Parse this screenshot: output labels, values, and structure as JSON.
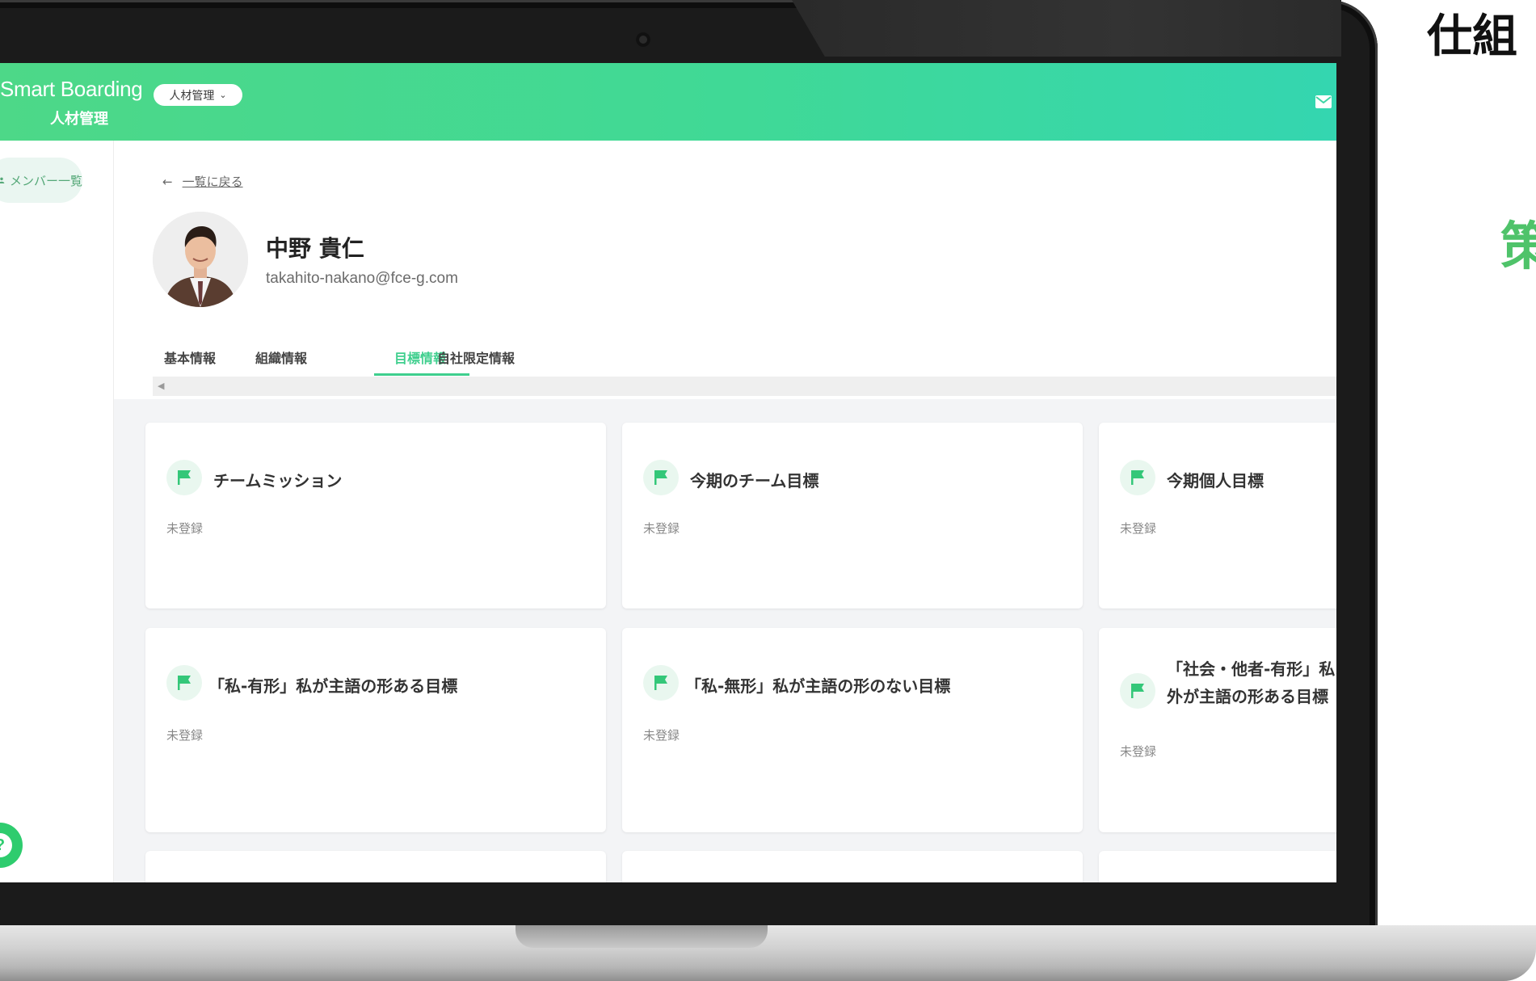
{
  "right_panel": {
    "heading": "仕組",
    "green_text": "策"
  },
  "app": {
    "brand": "Smart Boarding",
    "brand_sub": "人材管理",
    "module_selector": "人材管理"
  },
  "sidebar": {
    "items": [
      {
        "label": "メンバー一覧"
      }
    ]
  },
  "profile": {
    "back_label": "一覧に戻る",
    "name": "中野 貴仁",
    "email": "takahito-nakano@fce-g.com"
  },
  "tabs": [
    {
      "label": "基本情報",
      "active": false
    },
    {
      "label": "組織情報",
      "active": false
    },
    {
      "label": "目標情報",
      "active": true
    },
    {
      "label": "自社限定情報",
      "active": false
    }
  ],
  "goal_cards": [
    {
      "title": "チームミッション",
      "status": "未登録"
    },
    {
      "title": "今期のチーム目標",
      "status": "未登録"
    },
    {
      "title": "今期個人目標",
      "status": "未登録"
    },
    {
      "title": "「私-有形」私が主語の形ある目標",
      "status": "未登録"
    },
    {
      "title": "「私-無形」私が主語の形のない目標",
      "status": "未登録"
    },
    {
      "title": "「社会・他者-有形」私以外が主語の形ある目標",
      "status": "未登録"
    }
  ],
  "colors": {
    "accent_green": "#3fcf8e",
    "header_gradient_start": "#4dd888",
    "header_gradient_end": "#34d6b0",
    "side_green_text": "#4fc36a"
  },
  "icons": [
    "mail-icon",
    "person-icon",
    "back-arrow-icon",
    "flag-icon",
    "help-icon",
    "chevron-down-icon",
    "scroll-left-icon"
  ]
}
